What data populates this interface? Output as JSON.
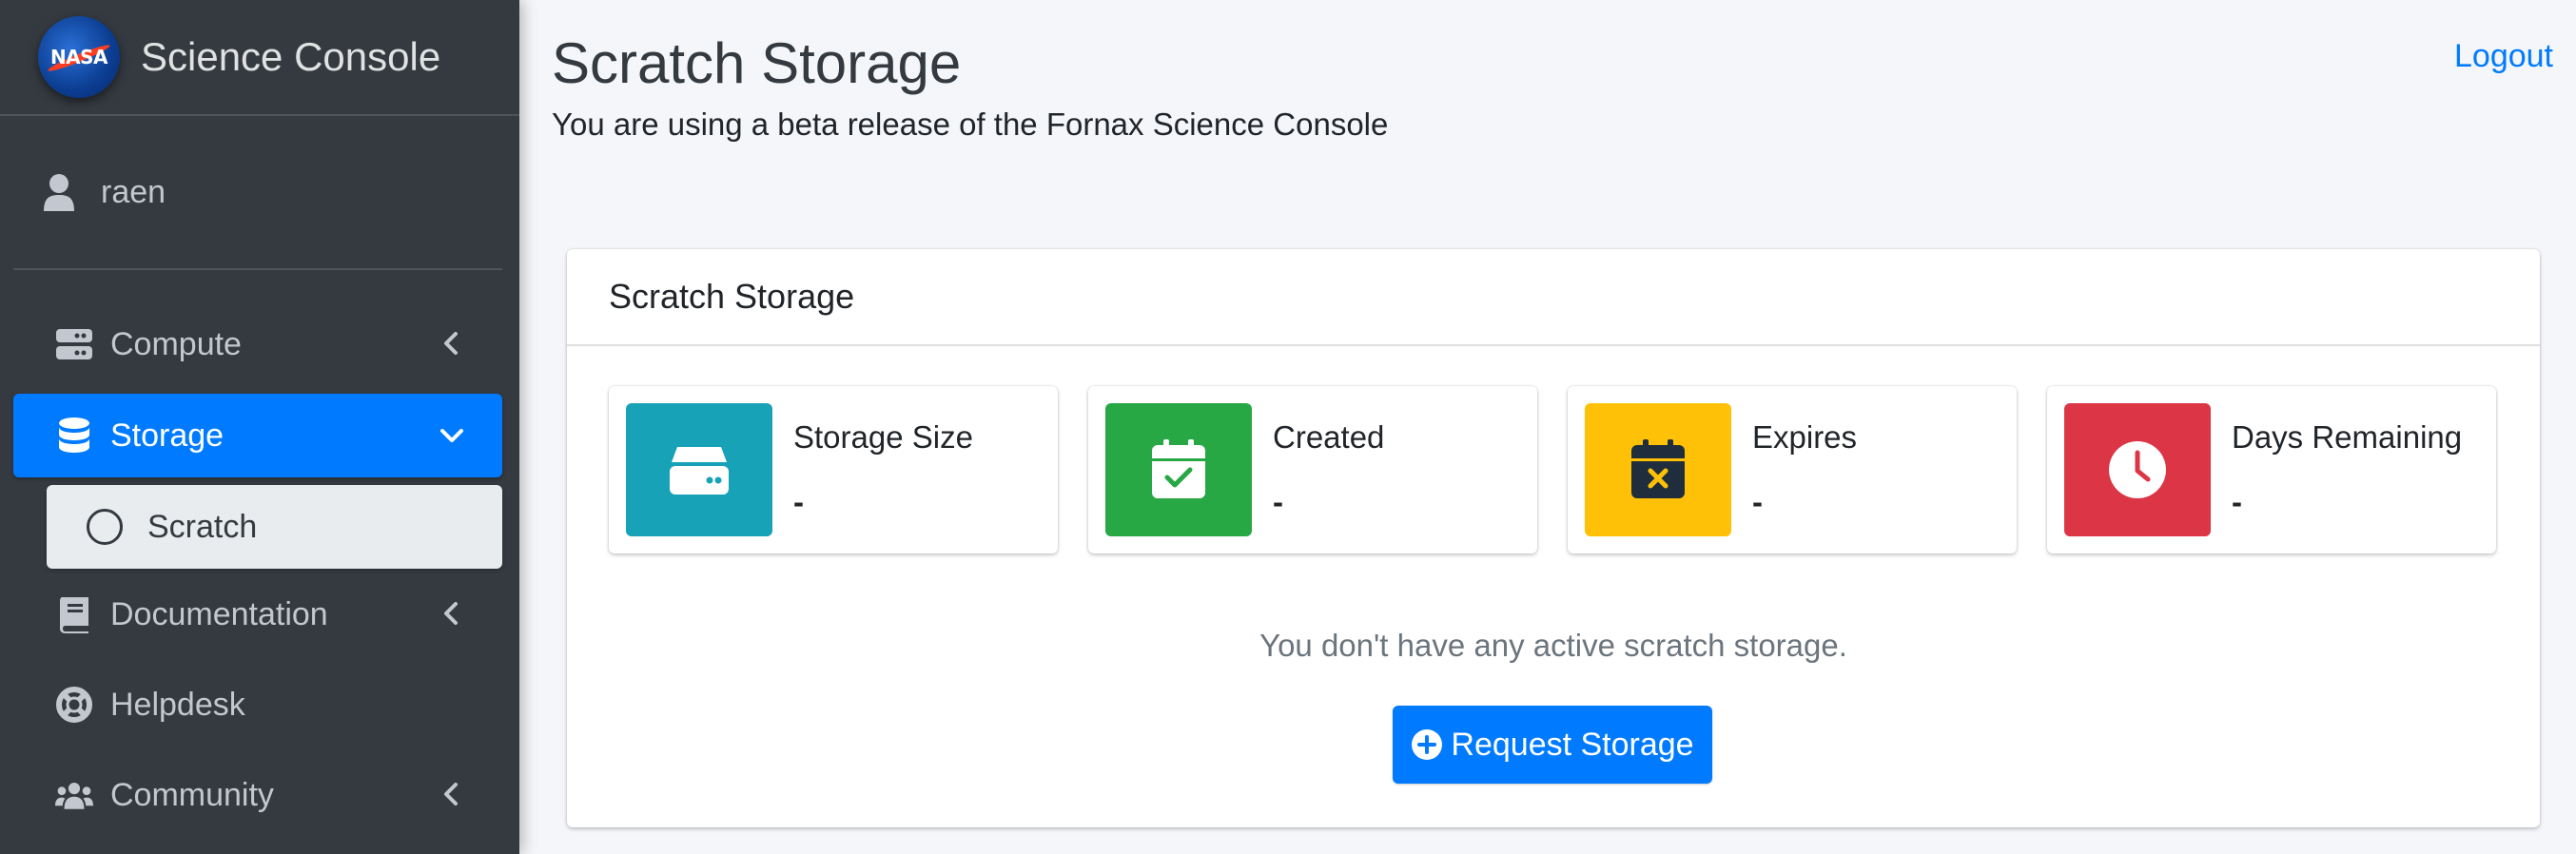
{
  "sidebar": {
    "brand_text": "Science Console",
    "logo_text": "NASA",
    "user_name": "raen",
    "items": [
      {
        "label": "Compute",
        "icon": "server-icon"
      },
      {
        "label": "Storage",
        "icon": "database-icon",
        "active": true
      },
      {
        "label": "Documentation",
        "icon": "book-icon"
      },
      {
        "label": "Helpdesk",
        "icon": "life-ring-icon"
      },
      {
        "label": "Community",
        "icon": "users-icon"
      }
    ],
    "sub_items": [
      {
        "label": "Scratch",
        "icon": "circle-icon"
      }
    ]
  },
  "header": {
    "title": "Scratch Storage",
    "subtitle": "You are using a beta release of the Fornax Science Console",
    "logout_label": "Logout"
  },
  "card": {
    "title": "Scratch Storage",
    "info_boxes": [
      {
        "label": "Storage Size",
        "value": "-",
        "color": "#17a2b8",
        "icon": "hard-drive-icon"
      },
      {
        "label": "Created",
        "value": "-",
        "color": "#28a745",
        "icon": "calendar-check-icon"
      },
      {
        "label": "Expires",
        "value": "-",
        "color": "#ffc107",
        "icon": "calendar-x-icon"
      },
      {
        "label": "Days Remaining",
        "value": "-",
        "color": "#dc3545",
        "icon": "clock-icon"
      }
    ],
    "empty_message": "You don't have any active scratch storage.",
    "request_button_label": "Request Storage"
  },
  "colors": {
    "sidebar_bg": "#343a40",
    "accent": "#007bff",
    "page_bg": "#f4f6f9"
  }
}
